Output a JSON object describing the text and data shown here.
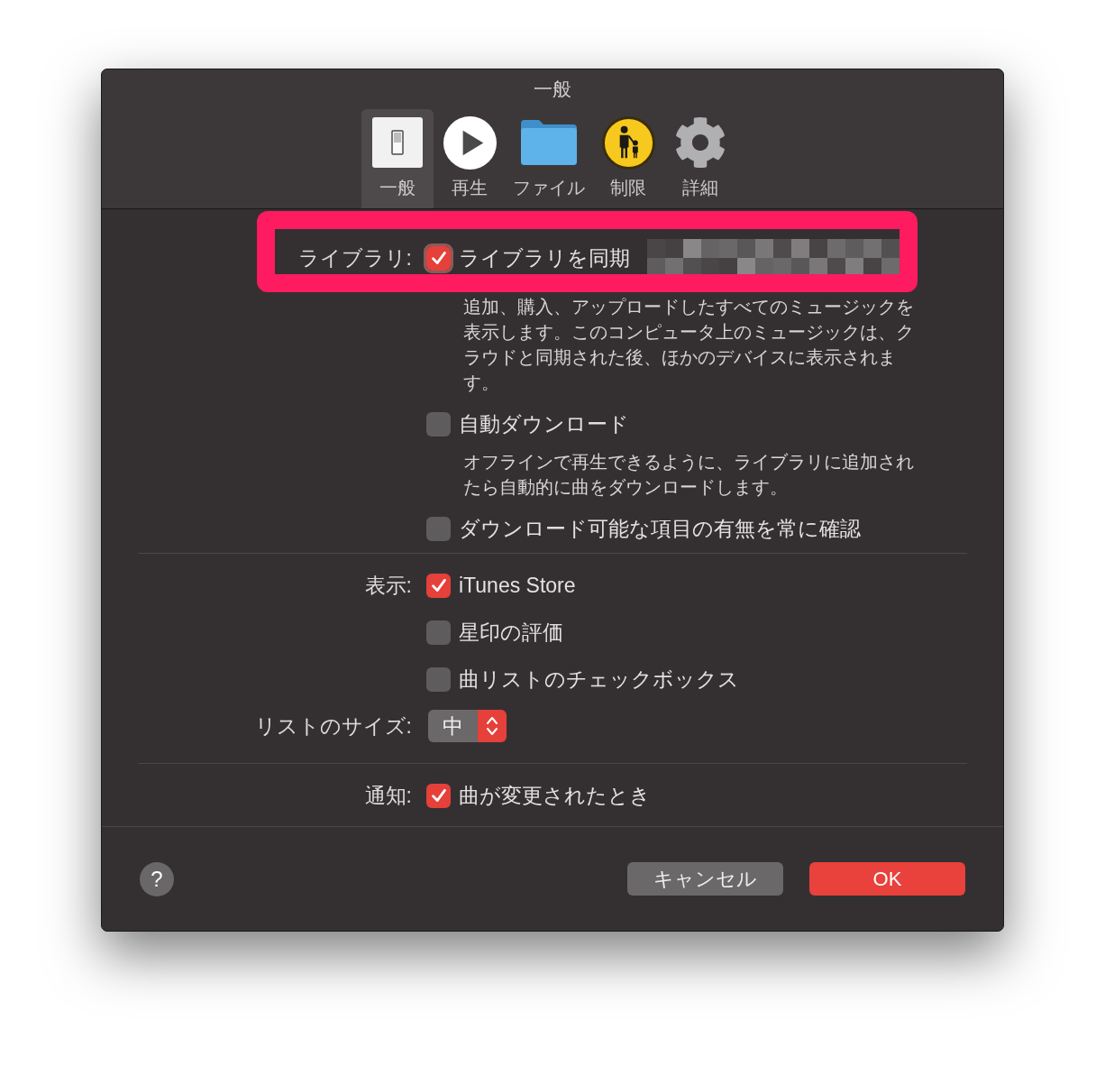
{
  "window": {
    "title": "一般"
  },
  "toolbar": [
    {
      "label": "一般",
      "selected": true
    },
    {
      "label": "再生",
      "selected": false
    },
    {
      "label": "ファイル",
      "selected": false
    },
    {
      "label": "制限",
      "selected": false
    },
    {
      "label": "詳細",
      "selected": false
    }
  ],
  "sections": [
    {
      "rows": [
        {
          "kind": "checkbox",
          "label": "ライブラリ:",
          "text": "ライブラリを同期",
          "checked": true,
          "focused": true,
          "highlighted": true,
          "redacted": true,
          "description": "追加、購入、アップロードしたすべてのミュージックを表示します。このコンピュータ上のミュージックは、クラウドと同期された後、ほかのデバイスに表示されます。"
        },
        {
          "kind": "checkbox",
          "text": "自動ダウンロード",
          "checked": false,
          "focused": false,
          "highlighted": false,
          "redacted": false,
          "description": "オフラインで再生できるように、ライブラリに追加されたら自動的に曲をダウンロードします。"
        },
        {
          "kind": "checkbox",
          "text": "ダウンロード可能な項目の有無を常に確認",
          "checked": false,
          "focused": false,
          "highlighted": false,
          "redacted": false
        }
      ]
    },
    {
      "rows": [
        {
          "kind": "checkbox",
          "label": "表示:",
          "text": "iTunes Store",
          "checked": true,
          "focused": false,
          "highlighted": false,
          "redacted": false
        },
        {
          "kind": "checkbox",
          "text": "星印の評価",
          "checked": false,
          "focused": false,
          "highlighted": false,
          "redacted": false
        },
        {
          "kind": "checkbox",
          "text": "曲リストのチェックボックス",
          "checked": false,
          "focused": false,
          "highlighted": false,
          "redacted": false
        },
        {
          "kind": "popup",
          "label": "リストのサイズ:",
          "value": "中"
        }
      ]
    },
    {
      "rows": [
        {
          "kind": "checkbox",
          "label": "通知:",
          "text": "曲が変更されたとき",
          "checked": true,
          "focused": false,
          "highlighted": false,
          "redacted": false
        }
      ]
    }
  ],
  "footer": {
    "help": "?",
    "buttons": [
      {
        "label": "キャンセル",
        "kind": "secondary"
      },
      {
        "label": "OK",
        "kind": "primary"
      }
    ]
  }
}
